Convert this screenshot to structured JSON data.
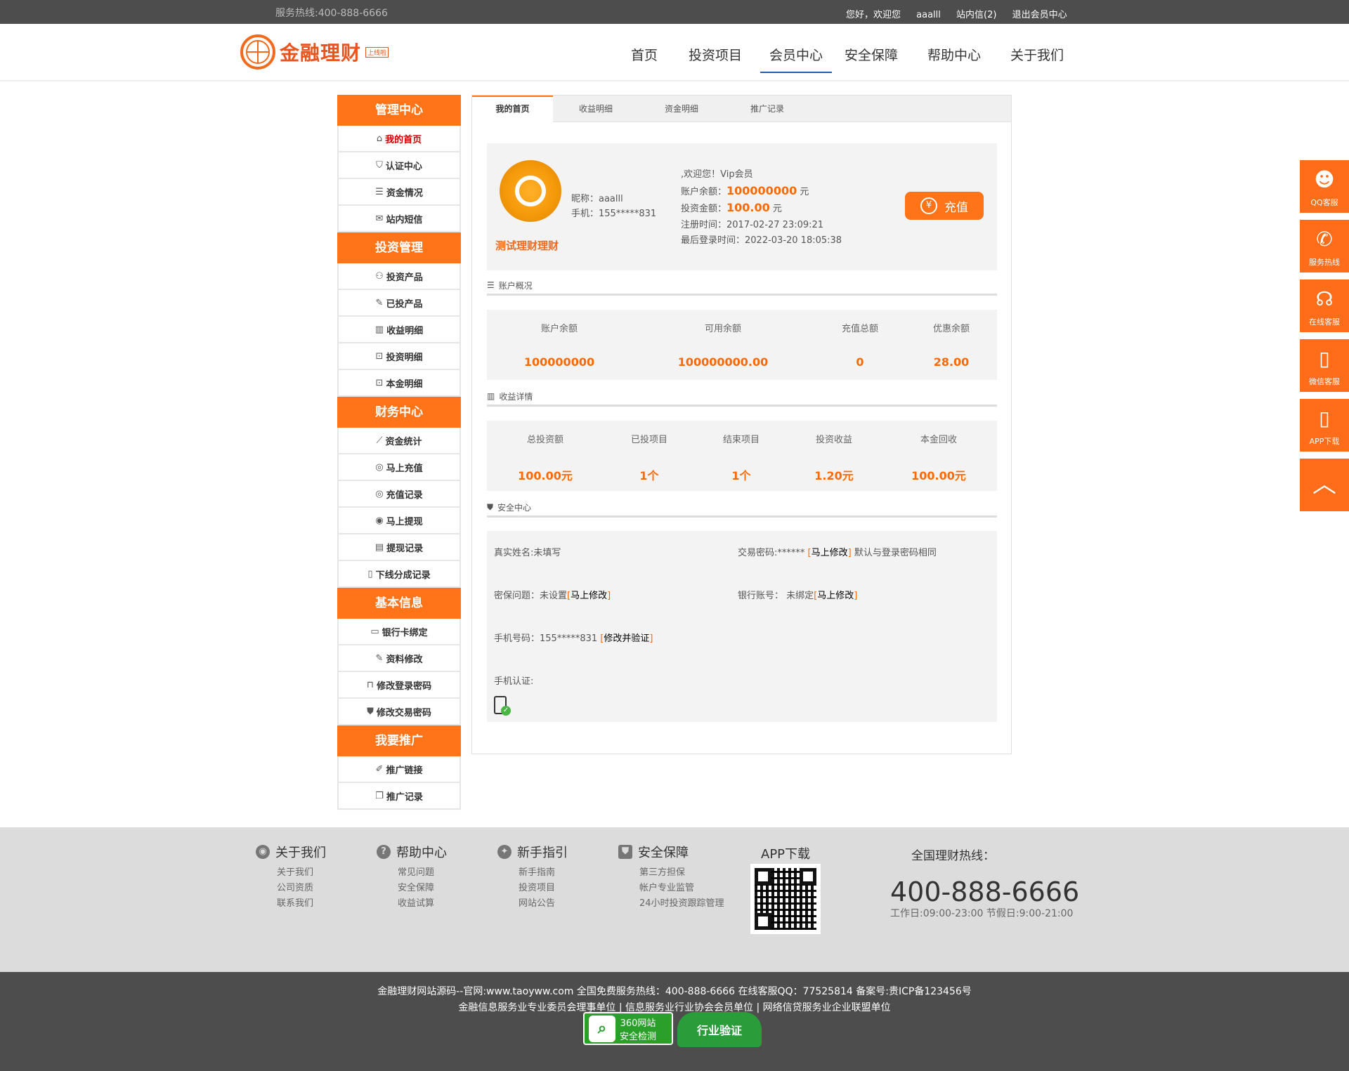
{
  "topbar": {
    "hotline": "服务热线:400-888-6666",
    "greeting": "您好，欢迎您",
    "username": "aaalll",
    "messages": "站内信(2)",
    "logout": "退出会员中心"
  },
  "header": {
    "logo_text": "金融理财",
    "logo_tag": "上线啦",
    "nav": [
      "首页",
      "投资项目",
      "会员中心",
      "安全保障",
      "帮助中心",
      "关于我们"
    ]
  },
  "sidebar": {
    "groups": [
      {
        "title": "管理中心",
        "items": [
          {
            "icon": "home-icon",
            "label": "我的首页"
          },
          {
            "icon": "shield-check-icon",
            "label": "认证中心"
          },
          {
            "icon": "list-icon",
            "label": "资金情况"
          },
          {
            "icon": "mail-icon",
            "label": "站内短信"
          }
        ]
      },
      {
        "title": "投资管理",
        "items": [
          {
            "icon": "grid-icon",
            "label": "投资产品"
          },
          {
            "icon": "edit-icon",
            "label": "已投产品"
          },
          {
            "icon": "chart-icon",
            "label": "收益明细"
          },
          {
            "icon": "box-yen-icon",
            "label": "投资明细"
          },
          {
            "icon": "box-yen-icon",
            "label": "本金明细"
          }
        ]
      },
      {
        "title": "财务中心",
        "items": [
          {
            "icon": "line-chart-icon",
            "label": "资金统计"
          },
          {
            "icon": "recharge-icon",
            "label": "马上充值"
          },
          {
            "icon": "record-icon",
            "label": "充值记录"
          },
          {
            "icon": "withdraw-icon",
            "label": "马上提现"
          },
          {
            "icon": "doc-icon",
            "label": "提现记录"
          },
          {
            "icon": "file-icon",
            "label": "下线分成记录"
          }
        ]
      },
      {
        "title": "基本信息",
        "items": [
          {
            "icon": "card-icon",
            "label": "银行卡绑定"
          },
          {
            "icon": "edit-icon",
            "label": "资料修改"
          },
          {
            "icon": "lock-icon",
            "label": "修改登录密码"
          },
          {
            "icon": "shield-icon",
            "label": "修改交易密码"
          }
        ]
      },
      {
        "title": "我要推广",
        "items": [
          {
            "icon": "link-icon",
            "label": "推广链接"
          },
          {
            "icon": "copy-icon",
            "label": "推广记录"
          }
        ]
      }
    ]
  },
  "tabs": [
    "我的首页",
    "收益明细",
    "资金明细",
    "推广记录"
  ],
  "profile": {
    "display_name": "测试理财理财",
    "nickname": "昵称：aaalll",
    "phone": "手机：155*****831",
    "welcome": ",欢迎您！Vip会员",
    "balance_label": "账户余额：",
    "balance": "100000000",
    "invest_label": "投资金额：",
    "invest": "100.00",
    "unit": "元",
    "register": "注册时间：2017-02-27 23:09:21",
    "last_login": "最后登录时间：2022-03-20 18:05:38",
    "recharge_button": "充值",
    "yen": "¥"
  },
  "overview": {
    "title": "账户概况",
    "cols": [
      {
        "label": "账户余额",
        "value": "100000000"
      },
      {
        "label": "可用余额",
        "value": "100000000.00"
      },
      {
        "label": "充值总额",
        "value": "0"
      },
      {
        "label": "优惠余额",
        "value": "28.00"
      }
    ]
  },
  "earnings": {
    "title": "收益详情",
    "cols": [
      {
        "label": "总投资额",
        "value": "100.00元"
      },
      {
        "label": "已投项目",
        "value": "1个"
      },
      {
        "label": "结束项目",
        "value": "1个"
      },
      {
        "label": "投资收益",
        "value": "1.20元"
      },
      {
        "label": "本金回收",
        "value": "100.00元"
      }
    ]
  },
  "security": {
    "title": "安全中心",
    "real_name": "真实姓名:未填写",
    "trade_pwd": "交易密码:******",
    "trade_pwd_link": "马上修改",
    "trade_pwd_note": "默认与登录密码相同",
    "question": "密保问题：未设置",
    "question_link": "马上修改",
    "bank": "银行账号：  未绑定",
    "bank_link": "马上修改",
    "phone": "手机号码：155*****831",
    "phone_link": "修改并验证",
    "phone_cert": "手机认证:"
  },
  "float_bar": [
    "QQ客服",
    "服务热线",
    "在线客服",
    "微信客服",
    "APP下载"
  ],
  "footer": {
    "cols": [
      {
        "title": "关于我们",
        "links": [
          "关于我们",
          "公司资质",
          "联系我们"
        ]
      },
      {
        "title": "帮助中心",
        "links": [
          "常见问题",
          "安全保障",
          "收益试算"
        ]
      },
      {
        "title": "新手指引",
        "links": [
          "新手指南",
          "投资项目",
          "网站公告"
        ]
      },
      {
        "title": "安全保障",
        "links": [
          "第三方担保",
          "帐户专业监管",
          "24小时投资跟踪管理"
        ]
      }
    ],
    "app_title": "APP下载",
    "hotline_title": "全国理财热线：",
    "hotline": "400-888-6666",
    "hours": "工作日:09:00-23:00 节假日:9:00-21:00"
  },
  "bottom": {
    "line1": "金融理财网站源码--官网:www.taoyww.com 全国免费服务热线：400-888-6666 在线客服QQ：77525814 备案号:贵ICP备123456号",
    "line2": "金融信息服务业专业委员会理事单位 | 信息服务业行业协会会员单位 | 网络信贷服务业企业联盟单位",
    "badge1_a": "360网站",
    "badge1_b": "安全检测",
    "badge2": "行业验证"
  }
}
